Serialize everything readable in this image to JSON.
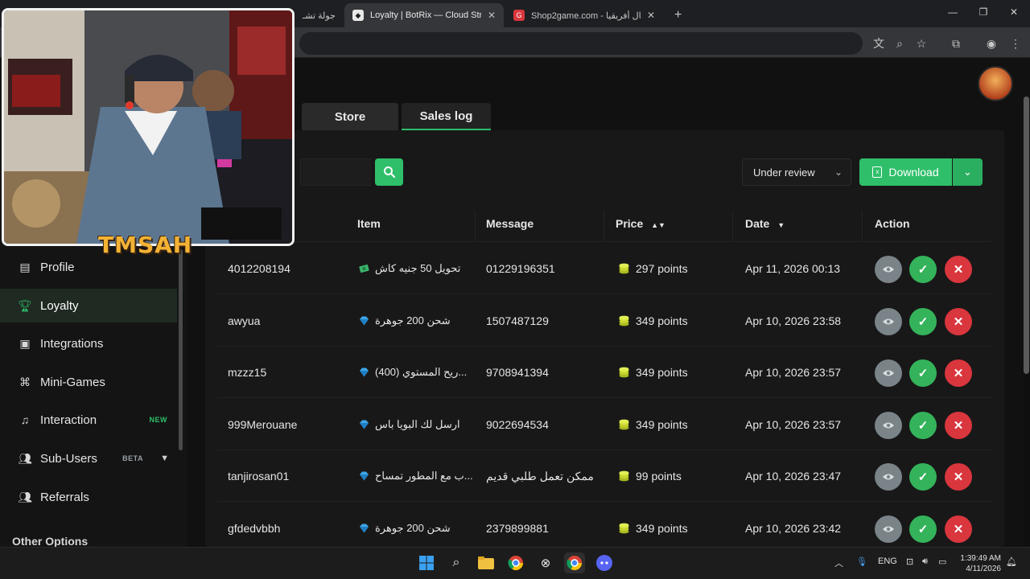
{
  "browser": {
    "tabs": [
      {
        "title": "جولة تشـ",
        "active": false
      },
      {
        "title": "Loyalty | BotRix — Cloud Stream",
        "active": true
      },
      {
        "title": "Shop2game.com - شمال أفريقيا",
        "active": false
      }
    ],
    "new_tab": "+",
    "window_controls": {
      "minimize": "—",
      "maximize": "❐",
      "close": "✕"
    }
  },
  "page_tabs": {
    "store": "Store",
    "sales_log": "Sales log"
  },
  "sidebar": {
    "items": [
      {
        "label": "Profile",
        "icon": "id-card-icon"
      },
      {
        "label": "Loyalty",
        "icon": "trophy-icon",
        "active": true
      },
      {
        "label": "Integrations",
        "icon": "integrations-icon"
      },
      {
        "label": "Mini-Games",
        "icon": "gamepad-icon"
      },
      {
        "label": "Interaction",
        "icon": "music-icon",
        "badge": "NEW"
      },
      {
        "label": "Sub-Users",
        "icon": "users-icon",
        "badge": "BETA"
      },
      {
        "label": "Referrals",
        "icon": "referrals-icon"
      }
    ],
    "other_options": "Other Options"
  },
  "filters": {
    "status": "Under review",
    "download": "Download"
  },
  "table": {
    "headers": {
      "item": "Item",
      "message": "Message",
      "price": "Price",
      "date": "Date",
      "action": "Action"
    },
    "rows": [
      {
        "user": "4012208194",
        "item": "تحويل 50 جنيه كاش",
        "item_icon": "money",
        "message": "01229196351",
        "price": "297 points",
        "date": "Apr 11, 2026 00:13"
      },
      {
        "user": "awyua",
        "item": "شحن 200 جوهرة",
        "item_icon": "diamond",
        "message": "1507487129",
        "price": "349 points",
        "date": "Apr 10, 2026 23:58"
      },
      {
        "user": "mzzz15",
        "item": "...ريح المستوي (400)",
        "item_icon": "diamond",
        "message": "9708941394",
        "price": "349 points",
        "date": "Apr 10, 2026 23:57"
      },
      {
        "user": "999Merouane",
        "item": "ارسل لك البويا باس",
        "item_icon": "diamond",
        "message": "9022694534",
        "price": "349 points",
        "date": "Apr 10, 2026 23:57"
      },
      {
        "user": "tanjirosan01",
        "item": "...ب مع المطور تمساح",
        "item_icon": "diamond",
        "message": "ممكن تعمل طلبي قديم",
        "price": "99 points",
        "date": "Apr 10, 2026 23:47"
      },
      {
        "user": "gfdedvbbh",
        "item": "شحن 200 جوهرة",
        "item_icon": "diamond",
        "message": "2379899881",
        "price": "349 points",
        "date": "Apr 10, 2026 23:42"
      }
    ]
  },
  "webcam": {
    "overlay_text": "TMSAH"
  },
  "taskbar": {
    "language": "ENG",
    "time": "1:39:49 AM",
    "date": "4/11/2026"
  },
  "colors": {
    "accent": "#2fbf6a",
    "danger": "#d9363e",
    "muted": "#7a8388"
  }
}
